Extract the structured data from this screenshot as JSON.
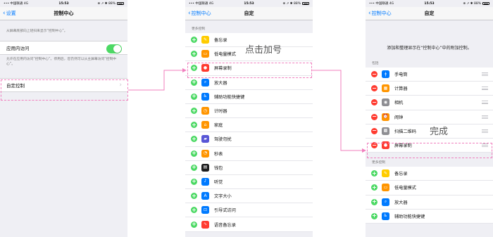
{
  "status_bars": [
    {
      "left": "••• 中国联通  4G",
      "time": "15:53",
      "right": "⊕ ↗ ✱ 88%"
    },
    {
      "left": "••• 中国联通  4G",
      "time": "15:53",
      "right": "⊕ ↗ ✱ 88%"
    },
    {
      "left": "••• 中国联通  4G",
      "time": "15:53",
      "right": "⊕ ↗ ✱ 88%"
    }
  ],
  "screen1": {
    "back": "设置",
    "title": "控制中心",
    "intro": "从屏幕底部向上轻扫来显示“控制中心”。",
    "app_access": "应用内访问",
    "app_access_note": "允许在应用内访问“控制中心”。停用后，您仍然可以从主屏幕访问“控制中心”。",
    "customize": "自定控制"
  },
  "screen2": {
    "back": "控制中心",
    "title": "自定",
    "section": "更多控制",
    "items": [
      {
        "label": "备忘录",
        "color": "#ffcc00",
        "glyph": "✎",
        "icon": "notes-icon"
      },
      {
        "label": "低电量模式",
        "color": "#ff9500",
        "glyph": "▭",
        "icon": "battery-icon"
      },
      {
        "label": "屏幕录制",
        "color": "#ff3b30",
        "glyph": "●",
        "icon": "record-icon"
      },
      {
        "label": "放大器",
        "color": "#007aff",
        "glyph": "⌕",
        "icon": "magnifier-icon"
      },
      {
        "label": "辅助功能快捷键",
        "color": "#007aff",
        "glyph": "♿",
        "icon": "accessibility-icon"
      },
      {
        "label": "计时器",
        "color": "#ff9500",
        "glyph": "◷",
        "icon": "timer-icon"
      },
      {
        "label": "家庭",
        "color": "#ff9500",
        "glyph": "⌂",
        "icon": "home-icon"
      },
      {
        "label": "驾驶勿扰",
        "color": "#5856d6",
        "glyph": "▰",
        "icon": "car-icon"
      },
      {
        "label": "秒表",
        "color": "#ff9500",
        "glyph": "◔",
        "icon": "stopwatch-icon"
      },
      {
        "label": "钱包",
        "color": "#1c1c1e",
        "glyph": "▤",
        "icon": "wallet-icon"
      },
      {
        "label": "听觉",
        "color": "#007aff",
        "glyph": "♪",
        "icon": "hearing-icon"
      },
      {
        "label": "文字大小",
        "color": "#007aff",
        "glyph": "A",
        "icon": "text-size-icon"
      },
      {
        "label": "引导式访问",
        "color": "#007aff",
        "glyph": "⊡",
        "icon": "guided-access-icon"
      },
      {
        "label": "语音备忘录",
        "color": "#ff3b30",
        "glyph": "∿",
        "icon": "voice-memo-icon"
      }
    ]
  },
  "screen3": {
    "back": "控制中心",
    "title": "自定",
    "intro": "添加和整理显示在“控制中心”中的附加控制。",
    "section_included": "包括",
    "included": [
      {
        "label": "手电筒",
        "color": "#007aff",
        "glyph": "ǂ",
        "icon": "flashlight-icon"
      },
      {
        "label": "计算器",
        "color": "#ff9500",
        "glyph": "▦",
        "icon": "calculator-icon"
      },
      {
        "label": "相机",
        "color": "#8e8e93",
        "glyph": "◉",
        "icon": "camera-icon"
      },
      {
        "label": "闹钟",
        "color": "#ff9500",
        "glyph": "⏰",
        "icon": "alarm-icon"
      },
      {
        "label": "扫描二维码",
        "color": "#8e8e93",
        "glyph": "▩",
        "icon": "qr-code-icon"
      },
      {
        "label": "屏幕录制",
        "color": "#ff3b30",
        "glyph": "●",
        "icon": "record-icon"
      }
    ],
    "section_more": "更多控制",
    "more": [
      {
        "label": "备忘录",
        "color": "#ffcc00",
        "glyph": "✎",
        "icon": "notes-icon"
      },
      {
        "label": "低电量模式",
        "color": "#ff9500",
        "glyph": "▭",
        "icon": "battery-icon"
      },
      {
        "label": "放大器",
        "color": "#007aff",
        "glyph": "⌕",
        "icon": "magnifier-icon"
      },
      {
        "label": "辅助功能快捷键",
        "color": "#007aff",
        "glyph": "♿",
        "icon": "accessibility-icon"
      }
    ]
  },
  "annotations": {
    "tap_plus": "点击加号",
    "done": "完成"
  },
  "colors": {
    "highlight": "#f07fbe",
    "ios_blue": "#007aff",
    "ios_green": "#4cd964",
    "ios_red": "#ff3b30"
  }
}
